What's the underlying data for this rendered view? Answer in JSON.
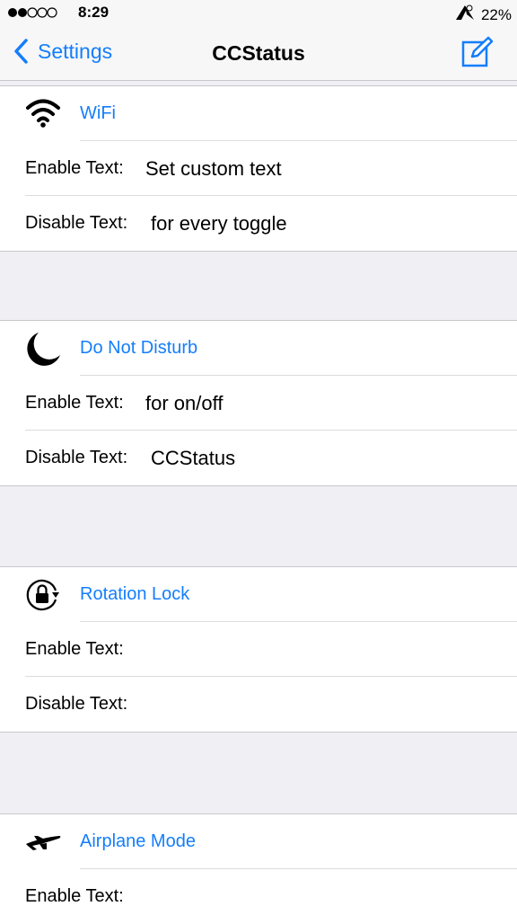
{
  "status_bar": {
    "time": "8:29",
    "battery_percent": "22%",
    "carrier_icon": "signal-dots-icon",
    "wifi_icon": "wifi-icon",
    "dnd_icon": "dnd-icon"
  },
  "nav": {
    "back_label": "Settings",
    "title": "CCStatus",
    "compose_icon": "compose-icon"
  },
  "colors": {
    "accent": "#147efb",
    "background": "#efeff4",
    "separator": "#c8c7cc"
  },
  "toggles": [
    {
      "name": "WiFi",
      "icon": "wifi-icon",
      "enable_label": "Enable Text:",
      "enable_value": "Set custom text",
      "disable_label": "Disable Text:",
      "disable_value": "for every toggle"
    },
    {
      "name": "Do Not Disturb",
      "icon": "moon-icon",
      "enable_label": "Enable Text:",
      "enable_value": "for on/off",
      "disable_label": "Disable Text:",
      "disable_value": "CCStatus"
    },
    {
      "name": "Rotation Lock",
      "icon": "rotation-lock-icon",
      "enable_label": "Enable Text:",
      "enable_value": "",
      "disable_label": "Disable Text:",
      "disable_value": ""
    },
    {
      "name": "Airplane Mode",
      "icon": "airplane-icon",
      "enable_label": "Enable Text:",
      "enable_value": ""
    }
  ]
}
